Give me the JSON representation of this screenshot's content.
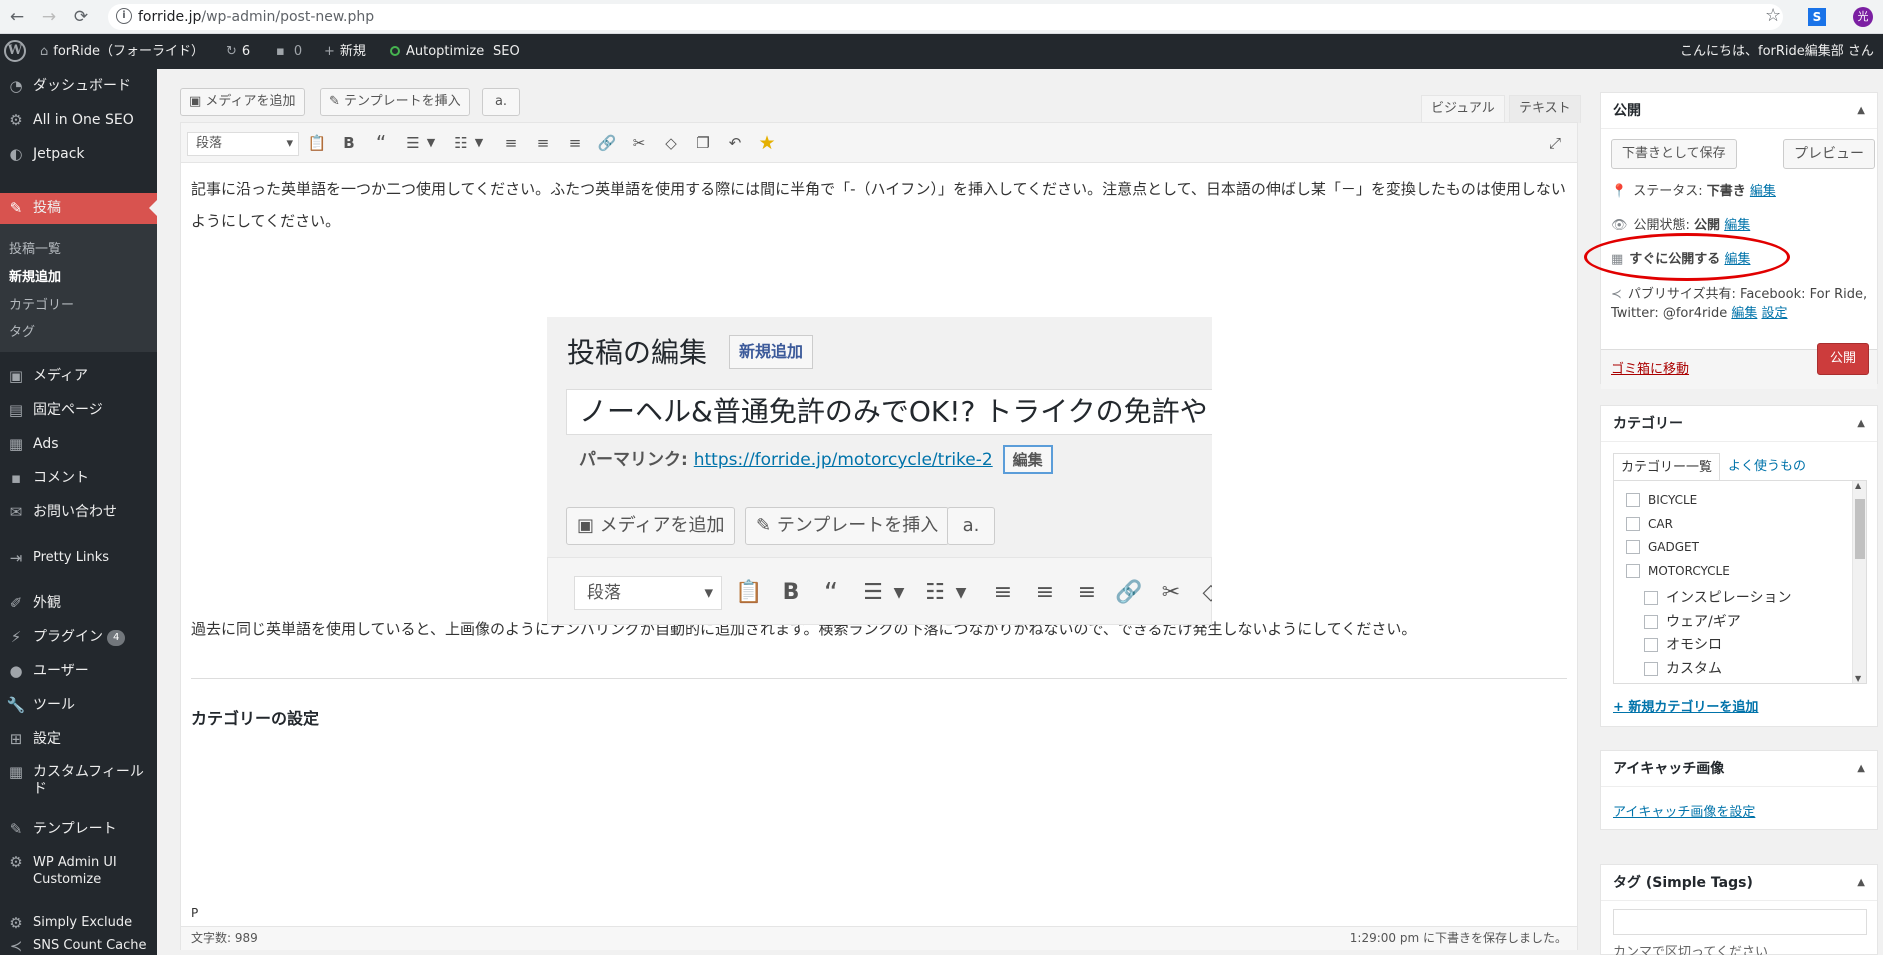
{
  "browser": {
    "url_host": "forride.jp",
    "url_path": "/wp-admin/post-new.php"
  },
  "adminbar": {
    "site_name": "forRide（フォーライド）",
    "updates_count": "6",
    "comments_count": "0",
    "new_label": "新規",
    "autoptimize_label": "Autoptimize",
    "seo_label": "SEO",
    "greeting": "こんにちは、forRide編集部 さん"
  },
  "sidebar": {
    "items": [
      {
        "label": "ダッシュボード",
        "icon": "dashboard-icon"
      },
      {
        "label": "All in One SEO",
        "icon": "gear-icon"
      },
      {
        "label": "Jetpack",
        "icon": "jetpack-icon"
      },
      {
        "label": "投稿",
        "icon": "pin-icon"
      },
      {
        "label": "メディア",
        "icon": "media-icon"
      },
      {
        "label": "固定ページ",
        "icon": "page-icon"
      },
      {
        "label": "Ads",
        "icon": "ads-icon"
      },
      {
        "label": "コメント",
        "icon": "comment-icon"
      },
      {
        "label": "お問い合わせ",
        "icon": "mail-icon"
      },
      {
        "label": "Pretty Links",
        "icon": "link-icon"
      },
      {
        "label": "外観",
        "icon": "brush-icon"
      },
      {
        "label": "プラグイン",
        "icon": "plugin-icon",
        "badge": "4"
      },
      {
        "label": "ユーザー",
        "icon": "user-icon"
      },
      {
        "label": "ツール",
        "icon": "wrench-icon"
      },
      {
        "label": "設定",
        "icon": "settings-icon"
      },
      {
        "label": "カスタムフィールド",
        "icon": "table-icon"
      },
      {
        "label": "テンプレート",
        "icon": "pencil-icon"
      },
      {
        "label": "WP Admin UI Customize",
        "icon": "gear-icon"
      },
      {
        "label": "Simply Exclude",
        "icon": "gear-icon"
      },
      {
        "label": "SNS Count Cache",
        "icon": "share-icon"
      }
    ],
    "submenu": [
      "投稿一覧",
      "新規追加",
      "カテゴリー",
      "タグ"
    ]
  },
  "editor": {
    "add_media": "メディアを追加",
    "insert_template": "テンプレートを挿入",
    "amazon": "a.",
    "tab_visual": "ビジュアル",
    "tab_text": "テキスト",
    "format_select": "段落",
    "paragraph1": "記事に沿った英単語を一つか二つ使用してください。ふたつ英単語を使用する際には間に半角で「-（ハイフン）」を挿入してください。注意点として、日本語の伸ばし某「－」を変換したものは使用しないようにしてください。",
    "paragraph2": "過去に同じ英単語を使用していると、上画像のようにナンバリングが自動的に追加されます。検索ランクの下落につながりかねないので、できるだけ発生しないようにしてください。",
    "heading": "カテゴリーの設定",
    "path": "P",
    "word_count": "文字数: 989",
    "saved_status": "1:29:00 pm に下書きを保存しました。"
  },
  "embedded": {
    "title": "投稿の編集",
    "new_button": "新規追加",
    "post_title": "ノーヘル&普通免許のみでOK!? トライクの免許や",
    "permalink_label": "パーマリンク:",
    "permalink_url": "https://forride.jp/motorcycle/trike-2",
    "edit_button": "編集",
    "add_media": "メディアを追加",
    "insert_template": "テンプレートを挿入",
    "amazon": "a.",
    "format_select": "段落"
  },
  "publish_box": {
    "title": "公開",
    "save_draft": "下書きとして保存",
    "preview": "プレビュー",
    "status_label": "ステータス:",
    "status_value": "下書き",
    "visibility_label": "公開状態:",
    "visibility_value": "公開",
    "schedule_label": "すぐに公開する",
    "edit": "編集",
    "publicize_line1": "パブリサイズ共有: Facebook: For Ride,",
    "publicize_line2": "Twitter: @for4ride",
    "settings": "設定",
    "trash": "ゴミ箱に移動",
    "publish": "公開"
  },
  "category_box": {
    "title": "カテゴリー",
    "tab_all": "カテゴリー一覧",
    "tab_popular": "よく使うもの",
    "items": [
      "BICYCLE",
      "CAR",
      "GADGET",
      "MOTORCYCLE"
    ],
    "subitems": [
      "インスピレーション",
      "ウェア/ギア",
      "オモシロ",
      "カスタム"
    ],
    "add_new": "+ 新規カテゴリーを追加"
  },
  "featured_box": {
    "title": "アイキャッチ画像",
    "set_link": "アイキャッチ画像を設定"
  },
  "tags_box": {
    "title": "タグ (Simple Tags)",
    "hint": "カンマで区切ってください"
  }
}
